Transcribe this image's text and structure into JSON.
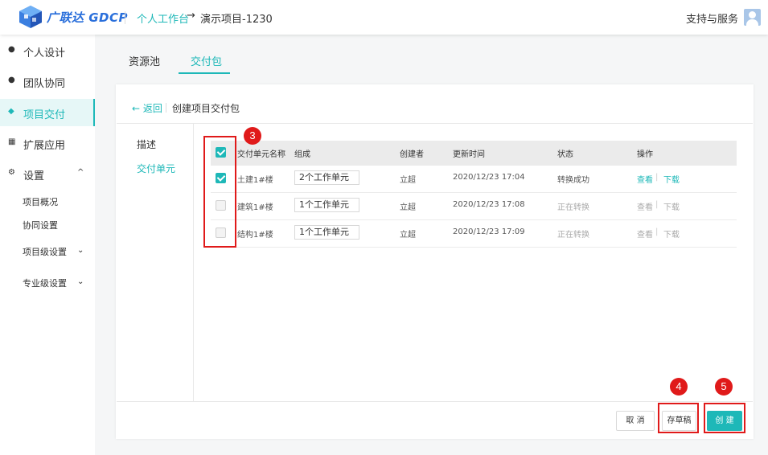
{
  "header": {
    "brand": "广联达 GDCP",
    "breadcrumb_root": "个人工作台",
    "breadcrumb_arrow": "→",
    "breadcrumb_project": "演示项目-1230",
    "support": "支持与服务"
  },
  "sidebar": {
    "items": [
      {
        "label": "个人设计",
        "icon": "user-icon"
      },
      {
        "label": "团队协同",
        "icon": "team-icon"
      },
      {
        "label": "项目交付",
        "icon": "layers-icon"
      },
      {
        "label": "扩展应用",
        "icon": "grid-icon"
      },
      {
        "label": "设置",
        "icon": "gear-icon"
      }
    ],
    "sub_items": [
      {
        "label": "项目概况"
      },
      {
        "label": "协同设置"
      },
      {
        "label": "项目级设置"
      },
      {
        "label": "专业级设置"
      }
    ]
  },
  "tabs": [
    {
      "label": "资源池"
    },
    {
      "label": "交付包"
    }
  ],
  "card": {
    "back": "← 返回",
    "title": "创建项目交付包",
    "left_tabs": [
      {
        "label": "描述"
      },
      {
        "label": "交付单元"
      }
    ]
  },
  "table": {
    "headers": [
      "交付单元名称",
      "组成",
      "创建者",
      "更新时间",
      "状态",
      "操作"
    ],
    "rows": [
      {
        "name": "土建1#楼",
        "composition": "2个工作单元",
        "creator": "立超",
        "updated": "2020/12/23 17:04",
        "status": "转换成功",
        "view": "查看",
        "download": "下载",
        "checked": true
      },
      {
        "name": "建筑1#楼",
        "composition": "1个工作单元",
        "creator": "立超",
        "updated": "2020/12/23 17:08",
        "status": "正在转换",
        "view": "查看",
        "download": "下载",
        "checked": false
      },
      {
        "name": "结构1#楼",
        "composition": "1个工作单元",
        "creator": "立超",
        "updated": "2020/12/23 17:09",
        "status": "正在转换",
        "view": "查看",
        "download": "下载",
        "checked": false
      }
    ],
    "select_all_checked": true,
    "op_separator": "|"
  },
  "buttons": {
    "cancel": "取 消",
    "draft": "存草稿",
    "create": "创 建"
  },
  "annotations": {
    "marker_3": "3",
    "marker_4": "4",
    "marker_5": "5"
  },
  "colors": {
    "accent": "#1eb8b8",
    "annotation": "#e01a1a"
  }
}
